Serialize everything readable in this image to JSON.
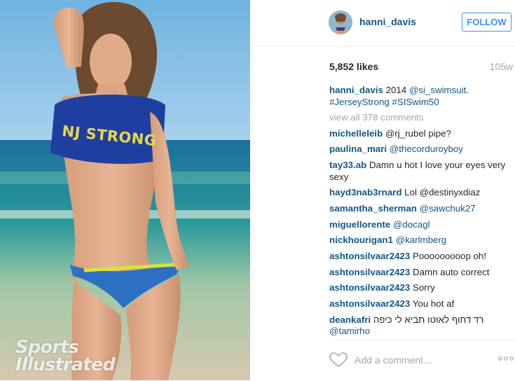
{
  "photo": {
    "watermark_line1": "Sports",
    "watermark_line2": "Illustrated",
    "shirt_text": "NJ STRONG"
  },
  "header": {
    "username": "hanni_davis",
    "follow_label": "FOLLOW"
  },
  "meta": {
    "likes": "5,852 likes",
    "age": "105w"
  },
  "caption": {
    "user": "hanni_davis",
    "text": "2014",
    "mention": "@si_swimsuit",
    "period": ".",
    "hashtags": "#JerseyStrong #SISwim50"
  },
  "view_all": "view all 378 comments",
  "comments": [
    {
      "user": "michelleleib",
      "text": "@rj_rubel pipe?"
    },
    {
      "user": "paulina_mari",
      "text": "@thecorduroyboy"
    },
    {
      "user": "tay33.ab",
      "text": "Damn u hot I love your eyes very sexy"
    },
    {
      "user": "hayd3nab3rnard",
      "text": "Lol @destinyxdiaz"
    },
    {
      "user": "samantha_sherman",
      "text": "@sawchuk27"
    },
    {
      "user": "miguellorente",
      "text": "@docagl"
    },
    {
      "user": "nickhourigan1",
      "text": "@karlmberg"
    },
    {
      "user": "ashtonsilvaar2423",
      "text": "Pooooooooop oh!"
    },
    {
      "user": "ashtonsilvaar2423",
      "text": "Damn auto correct"
    },
    {
      "user": "ashtonsilvaar2423",
      "text": "Sorry"
    },
    {
      "user": "ashtonsilvaar2423",
      "text": "You hot af"
    },
    {
      "user": "deankafri",
      "text": "רד דחוף לאוטו תביא לי כיפה",
      "mention": "@tamirho"
    }
  ],
  "footer": {
    "add_comment_placeholder": "Add a comment..."
  },
  "icons": {
    "like": "heart-icon",
    "more": "more-options-icon"
  },
  "colors": {
    "username": "#125688",
    "follow": "#3897f0",
    "muted": "#a5a7aa"
  }
}
